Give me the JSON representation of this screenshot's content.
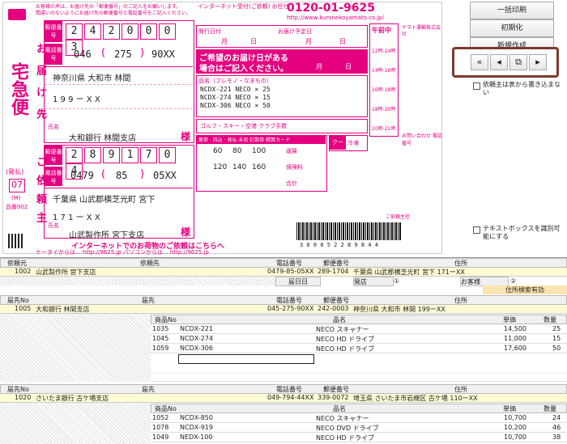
{
  "slip": {
    "header_note_1": "お客様の声は、お届け先の「郵便番号」のご記入をお願いします。",
    "header_note_2": "間違いのないようにお届け先の郵便番号と電話番号をご記入ください。",
    "side_label": "宅急便",
    "side_sub": "(発払)",
    "side_code": "07",
    "side_m": "(M)",
    "side_id": "品番902",
    "to_postal_digits": [
      "2",
      "4",
      "2",
      "0",
      "0",
      "0",
      "3"
    ],
    "to_phone": [
      "046",
      "275",
      "90XX"
    ],
    "to_address_1": "神奈川県 大和市 林間",
    "to_address_2": "1 9 9 ー X X",
    "to_name": "大和銀行 林間支店",
    "to_honorific": "様",
    "from_postal_digits": [
      "2",
      "8",
      "9",
      "1",
      "7",
      "0",
      "4"
    ],
    "from_phone": [
      "0479",
      "85",
      "05XX"
    ],
    "from_address_1": "千葉県 山武郡横芝光町 宮下",
    "from_address_2": "1 7 1 ー X X",
    "from_name": "山武製作所 宮下支店",
    "from_honorific": "様",
    "label_postal": "郵便番号",
    "label_phone": "電話番号",
    "label_name": "氏名",
    "label_to_vertical": "お届け先",
    "label_from_vertical": "ご依頼主",
    "phone_number": "0120-01-9625",
    "internet_text": "インターネット受付(ご依頼) お任せ",
    "url": "http://www.kuronekoyamato.co.jp/",
    "ship_date_label": "発行日付",
    "month": "月",
    "day": "日",
    "delivery_date_label": "お届け予定日",
    "wish_box_text_1": "ご希望のお届け日がある",
    "wish_box_text_2": "場合はご記入ください。",
    "wish_month": "月",
    "wish_day": "日",
    "item_label": "品名（フレモノ・なまもの）",
    "items": [
      "NCDX-221 NECO × 25",
      "NCDX-274 NECO × 15",
      "NCDX-306 NECO × 50"
    ],
    "sports_label": "ゴルフ・スキー・空港 クラブ手数",
    "time_label": "午前中",
    "time_slots": [
      "12時-14時",
      "14時-16時",
      "16時-18時",
      "18時-20時",
      "20時-21時"
    ],
    "size_title": "集荷 · 持込 · 発払·未収·訂数券·精算カード",
    "size_values": [
      "60",
      "80",
      "100",
      "120",
      "140",
      "160"
    ],
    "fee_labels": [
      "運賃",
      "保険料",
      "合計"
    ],
    "yen": "円",
    "cool_label": "クール",
    "cool_options": [
      "冷凍",
      "冷蔵"
    ],
    "footer_text_1": "インターネットでのお荷物のご依頼はこちらへ",
    "footer_text_2": "ケータイからは... http://9625.jp パソコンからは... http://9625.jp",
    "sample_text": "ご依頼主控",
    "barcode_number": "3 0 0 0 5 2 2 8 9 8 4 4",
    "yamato_info": "ヤマト運輸株式会社",
    "fold_notice": "お問い合わせ 電話番号"
  },
  "right_panel": {
    "print_all_button": "一括印刷",
    "init_button": "初期化",
    "new_button": "新規作成",
    "nav_first": "«",
    "nav_prev": "◂",
    "nav_copy": "⧉",
    "nav_next": "▸",
    "option_label_1": "依頼主は表から書き込まない",
    "option_label_2": "テキストボックスを識別可能にする"
  },
  "grid1": {
    "headers": [
      "依頼元",
      "依頼先",
      "電話番号",
      "郵便番号",
      "住所"
    ],
    "row": {
      "id": "1002",
      "name": "山武製作所 宮下支店",
      "phone": "0479-85-05XX",
      "postal": "289-1704",
      "address": "千葉県 山武郡横芝光町 宮下 171ーXX"
    },
    "sub_labels": [
      "届日日",
      "発店",
      "お客様"
    ],
    "sub_values": [
      "①",
      "②"
    ],
    "search_status": "住所検索有効"
  },
  "grid2": {
    "headers": [
      "届先No",
      "届先",
      "電話番号",
      "郵便番号",
      "住所"
    ],
    "row": {
      "id": "1005",
      "name": "大和銀行 林間支店",
      "phone": "045-275-90XX",
      "postal": "242-0003",
      "address": "神奈川県 大和市 林間 199ーXX"
    },
    "item_headers": [
      "商品No",
      "品名",
      "単価",
      "数量"
    ],
    "items": [
      {
        "no": "1035",
        "code": "NCDX-221",
        "desc": "NECO スキャナー",
        "price": "14,500",
        "qty": "25"
      },
      {
        "no": "1045",
        "code": "NCDX-274",
        "desc": "NECO HD ドライブ",
        "price": "11,000",
        "qty": "15"
      },
      {
        "no": "1059",
        "code": "NCDX-306",
        "desc": "NECO HD ドライブ",
        "price": "17,600",
        "qty": "50"
      }
    ]
  },
  "grid3": {
    "headers": [
      "届先No",
      "届先",
      "電話番号",
      "郵便番号",
      "住所"
    ],
    "row": {
      "id": "1020",
      "name": "さいたま銀行 古ケ場支店",
      "phone": "049-794-44XX",
      "postal": "339-0072",
      "address": "埼玉県 さいたま市岩槻区 古ケ場 110ーXX"
    },
    "item_headers": [
      "商品No",
      "品名",
      "単価",
      "数量"
    ],
    "items": [
      {
        "no": "1052",
        "code": "NCDX-850",
        "desc": "NECO スキャナー",
        "price": "10,700",
        "qty": "24"
      },
      {
        "no": "1078",
        "code": "NCDX-919",
        "desc": "NECO DVD ドライブ",
        "price": "10,200",
        "qty": "46"
      },
      {
        "no": "1049",
        "code": "NEDX-100",
        "desc": "NECO HD ドライブ",
        "price": "10,700",
        "qty": "38"
      }
    ]
  }
}
